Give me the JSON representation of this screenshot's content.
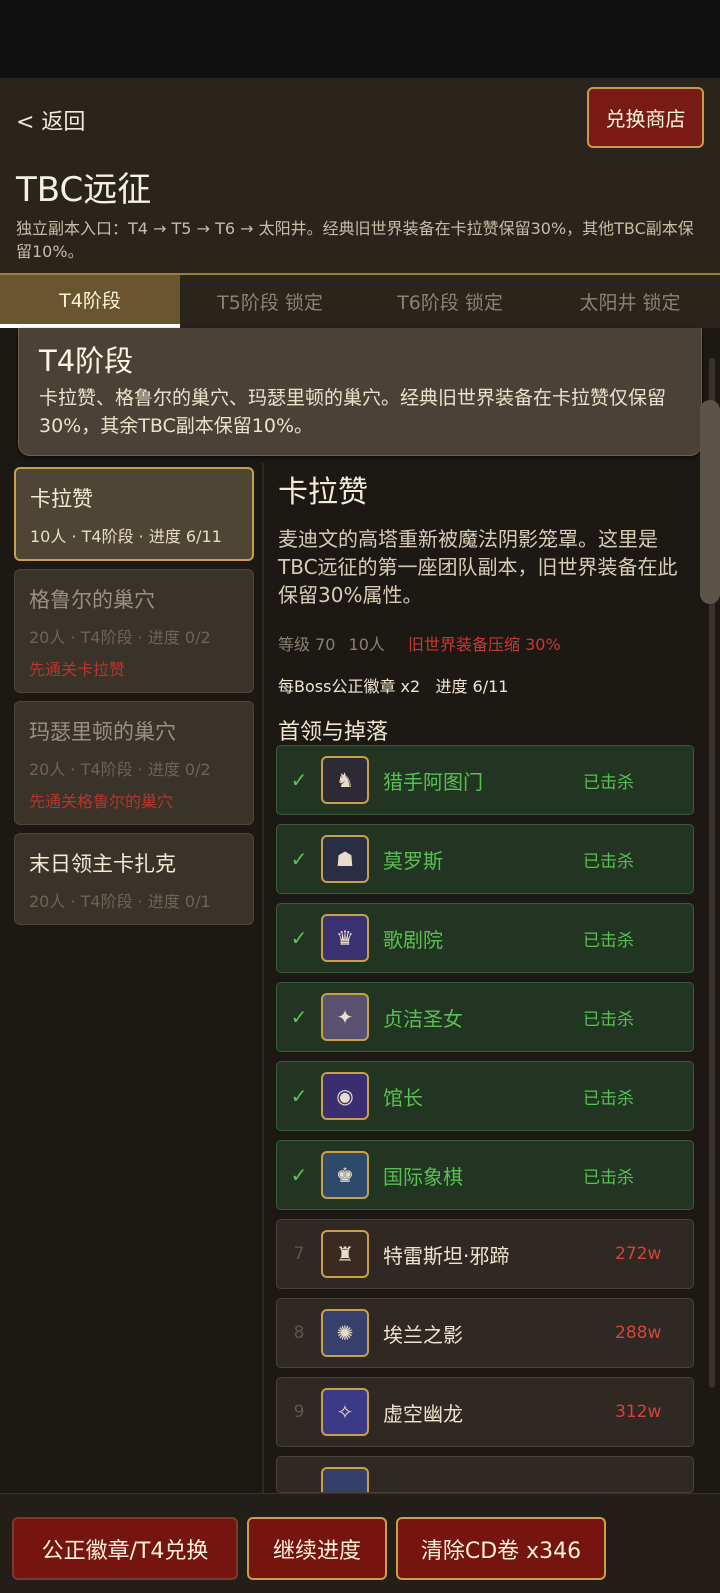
{
  "header": {
    "back_label": "< 返回",
    "shop_label": "兑换商店",
    "title": "TBC远征",
    "subtitle": "独立副本入口：T4 → T5 → T6 → 太阳井。经典旧世界装备在卡拉赞保留30%，其他TBC副本保留10%。"
  },
  "tabs": [
    {
      "label": "T4阶段"
    },
    {
      "label": "T5阶段 锁定"
    },
    {
      "label": "T6阶段 锁定"
    },
    {
      "label": "太阳井 锁定"
    }
  ],
  "phase": {
    "title": "T4阶段",
    "desc": "卡拉赞、格鲁尔的巢穴、玛瑟里顿的巢穴。经典旧世界装备在卡拉赞仅保留30%，其余TBC副本保留10%。"
  },
  "dungeons": [
    {
      "name": "卡拉赞",
      "meta": "10人 · T4阶段 · 进度 6/11",
      "req": ""
    },
    {
      "name": "格鲁尔的巢穴",
      "meta": "20人 · T4阶段 · 进度 0/2",
      "req": "先通关卡拉赞"
    },
    {
      "name": "玛瑟里顿的巢穴",
      "meta": "20人 · T4阶段 · 进度 0/2",
      "req": "先通关格鲁尔的巢穴"
    },
    {
      "name": "末日领主卡扎克",
      "meta": "20人 · T4阶段 · 进度 0/1",
      "req": ""
    }
  ],
  "detail": {
    "title": "卡拉赞",
    "desc": "麦迪文的高塔重新被魔法阴影笼罩。这里是TBC远征的第一座团队副本，旧世界装备在此保留30%属性。",
    "level": "等级 70",
    "size": "10人",
    "compress": "旧世界装备压缩 30%",
    "badges": "每Boss公正徽章 x2",
    "progress": "进度 6/11",
    "section_title": "首领与掉落"
  },
  "bosses": [
    {
      "idx": "✓",
      "name": "猎手阿图门",
      "status": "已击杀",
      "icon": "horseman-portrait"
    },
    {
      "idx": "✓",
      "name": "莫罗斯",
      "status": "已击杀",
      "icon": "butler-portrait"
    },
    {
      "idx": "✓",
      "name": "歌剧院",
      "status": "已击杀",
      "icon": "opera-portrait"
    },
    {
      "idx": "✓",
      "name": "贞洁圣女",
      "status": "已击杀",
      "icon": "maiden-portrait"
    },
    {
      "idx": "✓",
      "name": "馆长",
      "status": "已击杀",
      "icon": "curator-portrait"
    },
    {
      "idx": "✓",
      "name": "国际象棋",
      "status": "已击杀",
      "icon": "chess-portrait"
    },
    {
      "idx": "7",
      "name": "特雷斯坦·邪蹄",
      "status": "272w",
      "icon": "demon-portrait"
    },
    {
      "idx": "8",
      "name": "埃兰之影",
      "status": "288w",
      "icon": "shade-portrait"
    },
    {
      "idx": "9",
      "name": "虚空幽龙",
      "status": "312w",
      "icon": "netherspite-portrait"
    }
  ],
  "bottom": {
    "btn1": "公正徽章/T4兑换",
    "btn2": "继续进度",
    "btn3": "清除CD卷 x346"
  },
  "colors": {
    "accent_gold": "#c99f4a",
    "button_red": "#76140f",
    "killed_green": "#58c052",
    "warning_red": "#c83a30"
  }
}
